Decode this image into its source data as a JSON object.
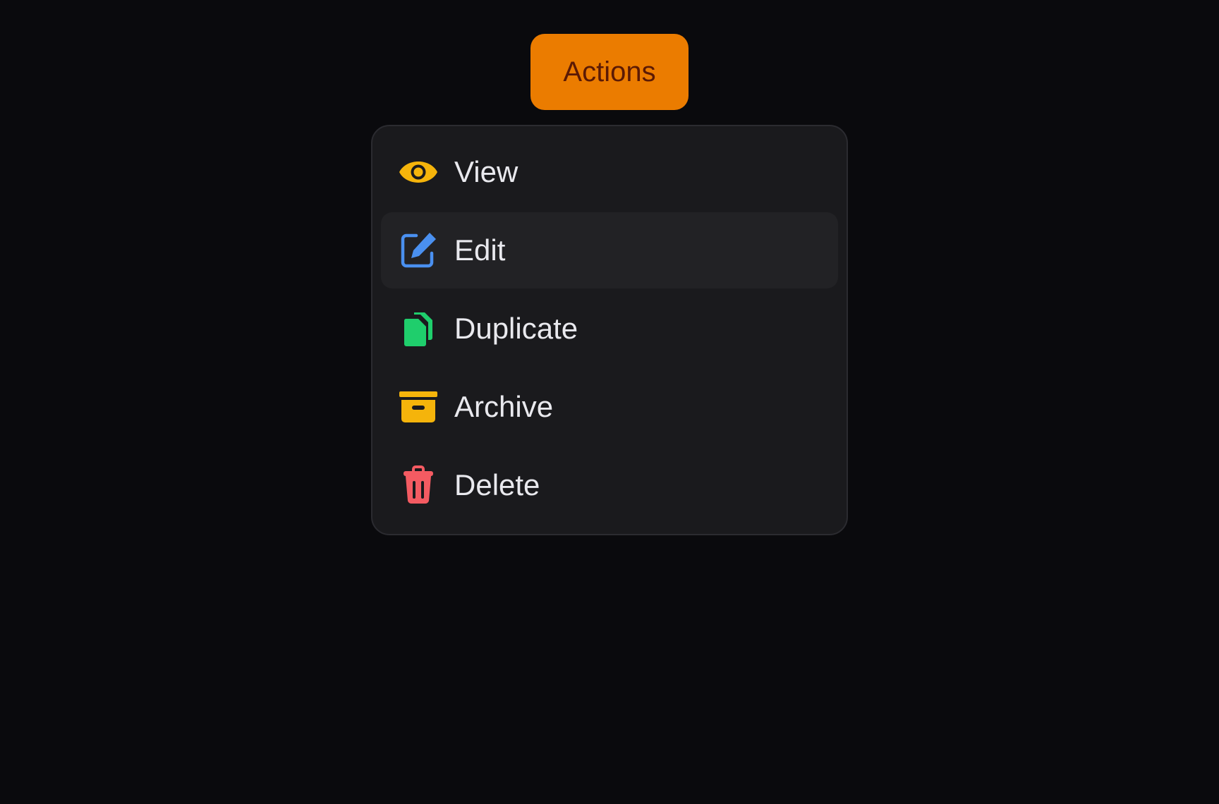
{
  "trigger": {
    "label": "Actions"
  },
  "menu": {
    "active_index": 1,
    "items": [
      {
        "label": "View",
        "icon": "eye-icon",
        "color": "#f5b40b"
      },
      {
        "label": "Edit",
        "icon": "edit-icon",
        "color": "#4a90f0"
      },
      {
        "label": "Duplicate",
        "icon": "duplicate-icon",
        "color": "#1fce6c"
      },
      {
        "label": "Archive",
        "icon": "archive-icon",
        "color": "#f5b40b"
      },
      {
        "label": "Delete",
        "icon": "trash-icon",
        "color": "#f45b62"
      }
    ]
  },
  "colors": {
    "background": "#0a0a0d",
    "accent": "#eb7c00",
    "menu_bg": "#1a1a1d"
  }
}
